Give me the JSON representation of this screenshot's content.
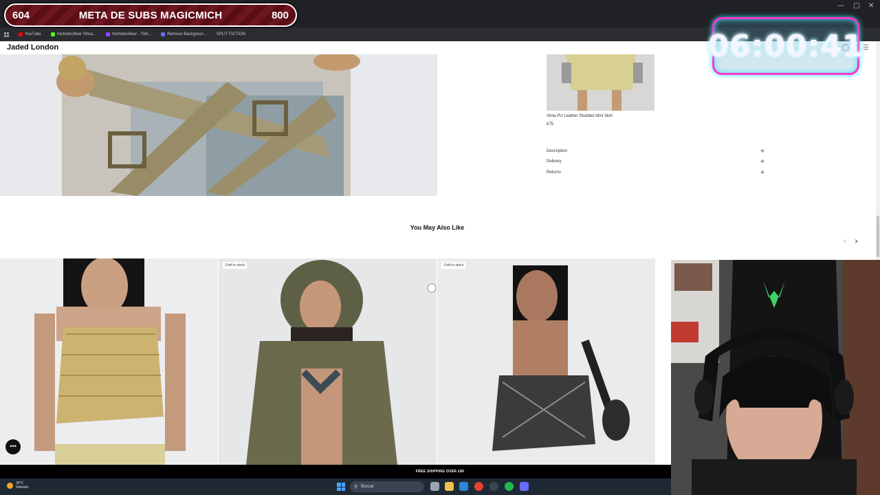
{
  "overlay": {
    "sub_goal": {
      "current": "604",
      "title": "META DE SUBS MAGICMICH",
      "target": "800"
    },
    "timer": "06:00:41"
  },
  "browser": {
    "bookmarks": [
      {
        "label": "YouTube",
        "color": "#ff0000"
      },
      {
        "label": "michelecilleer Strea...",
        "color": "#53fc18"
      },
      {
        "label": "michelecilleer - Twit...",
        "color": "#9146ff"
      },
      {
        "label": "Remove Backgroun...",
        "color": "#6b6bff"
      },
      {
        "label": "SPLIT FICTION",
        "color": "#2b2c2f"
      }
    ]
  },
  "site": {
    "brand": "Jaded London",
    "product": {
      "related_name": "Vinta PU Leather Studded Mini Skirt",
      "related_price": "£75",
      "accordion": [
        "Description",
        "Delivery",
        "Returns"
      ]
    },
    "also_like": {
      "title": "You May Also Like",
      "cards": [
        {
          "badge": ""
        },
        {
          "badge": "3 left in stock"
        },
        {
          "badge": "3 left in stock"
        }
      ]
    },
    "promo": "FREE SHIPPING OVER £80"
  },
  "taskbar": {
    "weather_temp": "30°C",
    "weather_text": "Soleado",
    "search_placeholder": "Buscar"
  }
}
